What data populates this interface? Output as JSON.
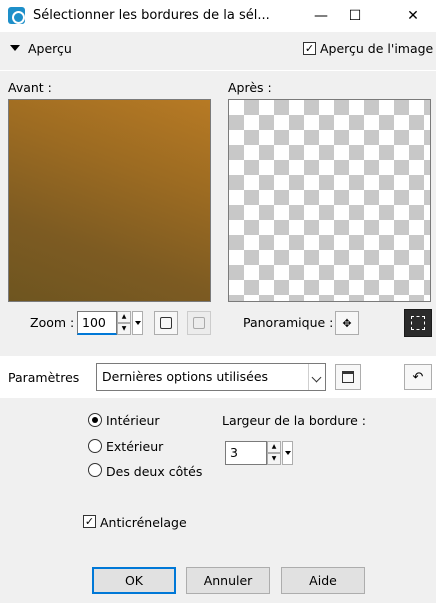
{
  "window": {
    "title": "Sélectionner les bordures de la sél...",
    "minimize_glyph": "—",
    "maximize_glyph": "☐",
    "close_glyph": "✕"
  },
  "preview": {
    "section_label": "Aperçu",
    "image_preview_label": "Aperçu de l'image",
    "image_preview_checked": true,
    "before_label": "Avant :",
    "after_label": "Après :",
    "zoom_label": "Zoom :",
    "zoom_value": "100",
    "pan_label": "Panoramique :",
    "pan_glyph": "✥"
  },
  "params": {
    "label": "Paramètres",
    "preset_value": "Dernières options utilisées"
  },
  "options": {
    "radio_inside": "Intérieur",
    "radio_outside": "Extérieur",
    "radio_both": "Des deux côtés",
    "selected": "Intérieur",
    "border_width_label": "Largeur de la bordure :",
    "border_width_value": "3",
    "antialias_label": "Anticrénelage",
    "antialias_checked": true
  },
  "buttons": {
    "ok": "OK",
    "cancel": "Annuler",
    "help": "Aide"
  },
  "colors": {
    "accent": "#0078d7",
    "app_icon": "#1e8fc9"
  }
}
